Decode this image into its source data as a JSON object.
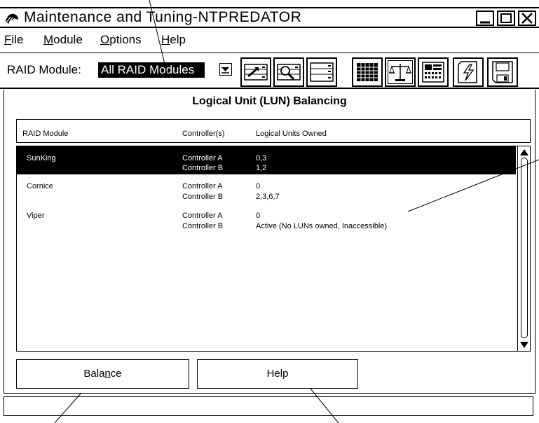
{
  "window": {
    "title": "Maintenance and Tuning-NTPREDATOR"
  },
  "menu": [
    {
      "label": "File",
      "underline": "F"
    },
    {
      "label": "Module",
      "underline": "M"
    },
    {
      "label": "Options",
      "underline": "O"
    },
    {
      "label": "Help",
      "underline": "H"
    }
  ],
  "toolbar": {
    "raid_label": "RAID Module:",
    "raid_value": "All RAID Modules",
    "icons": [
      "load-configuration-icon",
      "find-module-icon",
      "module-profile-icon",
      "logical-unit-grid-icon",
      "balance-scale-icon",
      "cache-parameters-icon",
      "recovery-icon",
      "save-disk-icon"
    ]
  },
  "panel": {
    "title": "Logical Unit (LUN) Balancing",
    "headers": {
      "module": "RAID Module",
      "controllers": "Controller(s)",
      "luns": "Logical Units Owned"
    },
    "rows": [
      {
        "module": "SunKing",
        "selected": true,
        "controllers": [
          {
            "name": "Controller A",
            "luns": "0,3"
          },
          {
            "name": "Controller B",
            "luns": "1,2"
          }
        ]
      },
      {
        "module": "Cornice",
        "selected": false,
        "controllers": [
          {
            "name": "Controller A",
            "luns": "0"
          },
          {
            "name": "Controller B",
            "luns": "2,3,6,7"
          }
        ]
      },
      {
        "module": "Viper",
        "selected": false,
        "controllers": [
          {
            "name": "Controller A",
            "luns": "0"
          },
          {
            "name": "Controller B",
            "luns": "Active (No LUNs owned, Inaccessible)"
          }
        ]
      }
    ]
  },
  "buttons": {
    "balance": {
      "pre": "Bala",
      "mnemonic": "n",
      "post": "ce"
    },
    "help": "Help"
  },
  "status": ""
}
